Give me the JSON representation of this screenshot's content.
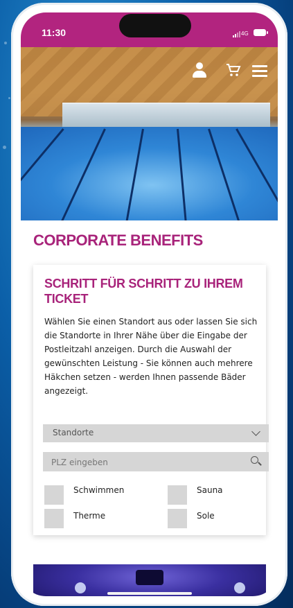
{
  "status_bar": {
    "time": "11:30",
    "network": "4G"
  },
  "header_icons": {
    "user": "user-icon",
    "cart": "cart-icon",
    "menu": "hamburger-menu-icon"
  },
  "page": {
    "title": "CORPORATE BENEFITS"
  },
  "card": {
    "title": "SCHRITT FÜR SCHRITT ZU IHREM TICKET",
    "text": "Wählen Sie einen Standort aus oder lassen Sie sich die Standorte in Ihrer Nähe über die Eingabe der Postleitzahl anzeigen. Durch die Auswahl der gewünschten Leistung - Sie können auch mehrere Häkchen setzen - werden Ihnen passende Bäder angezeigt.",
    "location_select": {
      "label": "Standorte"
    },
    "zip_input": {
      "placeholder": "PLZ eingeben",
      "value": ""
    },
    "options": [
      "Schwimmen",
      "Sauna",
      "Therme",
      "Sole"
    ]
  },
  "colors": {
    "brand": "#b2247f",
    "title": "#a8237a",
    "control_bg": "#d6d6d6"
  }
}
